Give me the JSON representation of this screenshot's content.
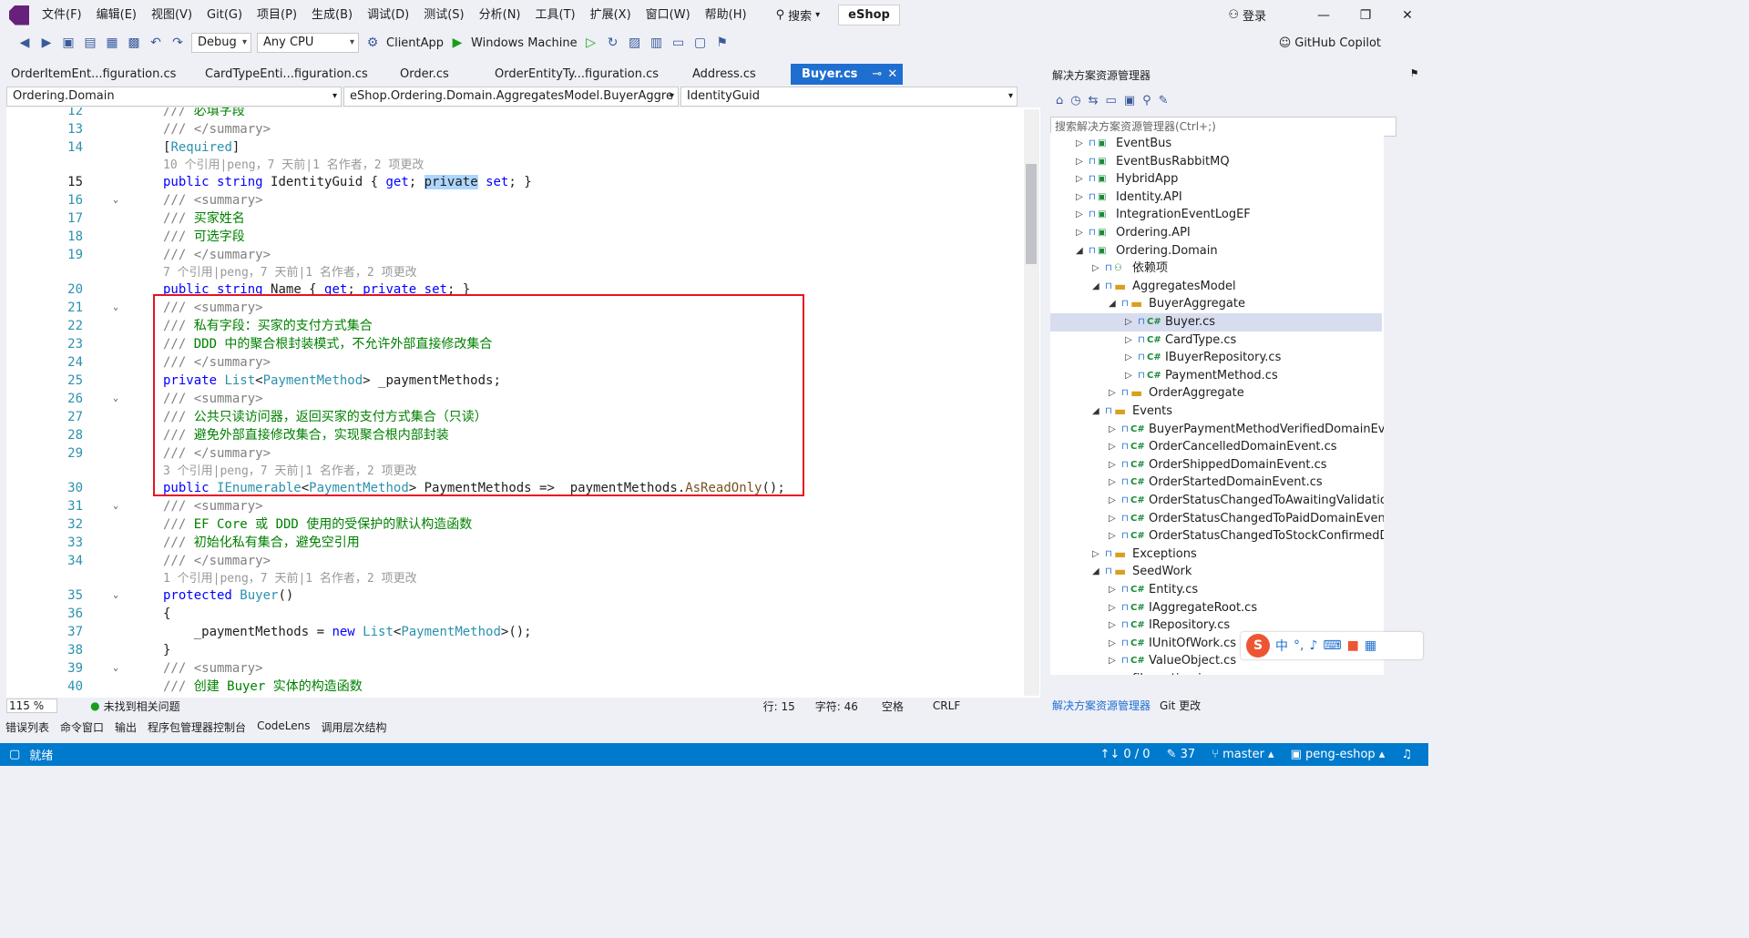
{
  "menubar": {
    "items": [
      "文件(F)",
      "编辑(E)",
      "视图(V)",
      "Git(G)",
      "项目(P)",
      "生成(B)",
      "调试(D)",
      "测试(S)",
      "分析(N)",
      "工具(T)",
      "扩展(X)",
      "窗口(W)",
      "帮助(H)"
    ],
    "search_label": "搜索",
    "solution_name": "eShop",
    "login_label": "登录"
  },
  "toolbar": {
    "config": "Debug",
    "platform": "Any CPU",
    "startup": "ClientApp",
    "run_target": "Windows Machine",
    "copilot": "GitHub Copilot"
  },
  "tabs": [
    {
      "label": "OrderItemEnt...figuration.cs",
      "active": false
    },
    {
      "label": "CardTypeEnti...figuration.cs",
      "active": false
    },
    {
      "label": "Order.cs",
      "active": false
    },
    {
      "label": "OrderEntityTy...figuration.cs",
      "active": false
    },
    {
      "label": "Address.cs",
      "active": false
    },
    {
      "label": "Buyer.cs",
      "active": true
    }
  ],
  "navbar": {
    "project": "Ordering.Domain",
    "type": "eShop.Ordering.Domain.AggregatesModel.BuyerAggre",
    "member": "IdentityGuid"
  },
  "editor": {
    "lines": [
      {
        "n": "12",
        "fold": false,
        "t": [
          [
            "cg",
            "/// "
          ],
          [
            "cm",
            "必填字段"
          ]
        ]
      },
      {
        "n": "13",
        "fold": false,
        "t": [
          [
            "cg",
            "/// </summary>"
          ]
        ]
      },
      {
        "n": "14",
        "fold": false,
        "t": [
          [
            "pl",
            "["
          ],
          [
            "at",
            "Required"
          ],
          [
            "pl",
            "]"
          ]
        ]
      },
      {
        "lens": "10 个引用|peng，7 天前|1 名作者，2 项更改"
      },
      {
        "n": "15",
        "fold": false,
        "cur": true,
        "t": [
          [
            "kw",
            "public "
          ],
          [
            "kw",
            "string "
          ],
          [
            "pl",
            "IdentityGuid { "
          ],
          [
            "kw",
            "get"
          ],
          [
            "pl",
            "; "
          ],
          [
            "hl",
            "private"
          ],
          [
            "pl",
            " "
          ],
          [
            "kw",
            "set"
          ],
          [
            "pl",
            "; }"
          ]
        ]
      },
      {
        "n": "16",
        "fold": true,
        "t": [
          [
            "cg",
            "/// <summary>"
          ]
        ]
      },
      {
        "n": "17",
        "fold": false,
        "t": [
          [
            "cg",
            "/// "
          ],
          [
            "cm",
            "买家姓名"
          ]
        ]
      },
      {
        "n": "18",
        "fold": false,
        "t": [
          [
            "cg",
            "/// "
          ],
          [
            "cm",
            "可选字段"
          ]
        ]
      },
      {
        "n": "19",
        "fold": false,
        "t": [
          [
            "cg",
            "/// </summary>"
          ]
        ]
      },
      {
        "lens": "7 个引用|peng，7 天前|1 名作者，2 项更改"
      },
      {
        "n": "20",
        "fold": false,
        "t": [
          [
            "kw",
            "public "
          ],
          [
            "kw",
            "string "
          ],
          [
            "pl",
            "Name { "
          ],
          [
            "kw",
            "get"
          ],
          [
            "pl",
            "; "
          ],
          [
            "kw",
            "private "
          ],
          [
            "kw",
            "set"
          ],
          [
            "pl",
            "; }"
          ]
        ]
      },
      {
        "n": "21",
        "fold": true,
        "t": [
          [
            "cg",
            "/// <summary>"
          ]
        ]
      },
      {
        "n": "22",
        "fold": false,
        "t": [
          [
            "cg",
            "/// "
          ],
          [
            "cm",
            "私有字段：买家的支付方式集合"
          ]
        ]
      },
      {
        "n": "23",
        "fold": false,
        "t": [
          [
            "cg",
            "/// "
          ],
          [
            "cm",
            "DDD 中的聚合根封装模式，不允许外部直接修改集合"
          ]
        ]
      },
      {
        "n": "24",
        "fold": false,
        "t": [
          [
            "cg",
            "/// </summary>"
          ]
        ]
      },
      {
        "n": "25",
        "fold": false,
        "t": [
          [
            "kw",
            "private "
          ],
          [
            "ty",
            "List"
          ],
          [
            "pl",
            "<"
          ],
          [
            "ty",
            "PaymentMethod"
          ],
          [
            "pl",
            "> _paymentMethods;"
          ]
        ]
      },
      {
        "n": "26",
        "fold": true,
        "t": [
          [
            "cg",
            "/// <summary>"
          ]
        ]
      },
      {
        "n": "27",
        "fold": false,
        "t": [
          [
            "cg",
            "/// "
          ],
          [
            "cm",
            "公共只读访问器，返回买家的支付方式集合（只读）"
          ]
        ]
      },
      {
        "n": "28",
        "fold": false,
        "t": [
          [
            "cg",
            "/// "
          ],
          [
            "cm",
            "避免外部直接修改集合，实现聚合根内部封装"
          ]
        ]
      },
      {
        "n": "29",
        "fold": false,
        "t": [
          [
            "cg",
            "/// </summary>"
          ]
        ]
      },
      {
        "lens": "3 个引用|peng，7 天前|1 名作者，2 项更改"
      },
      {
        "n": "30",
        "fold": false,
        "t": [
          [
            "kw",
            "public "
          ],
          [
            "ty",
            "IEnumerable"
          ],
          [
            "pl",
            "<"
          ],
          [
            "ty",
            "PaymentMethod"
          ],
          [
            "pl",
            "> PaymentMethods => _paymentMethods."
          ],
          [
            "mt",
            "AsReadOnly"
          ],
          [
            "pl",
            "();"
          ]
        ]
      },
      {
        "n": "31",
        "fold": true,
        "t": [
          [
            "cg",
            "/// <summary>"
          ]
        ]
      },
      {
        "n": "32",
        "fold": false,
        "t": [
          [
            "cg",
            "/// "
          ],
          [
            "cm",
            "EF Core 或 DDD 使用的受保护的默认构造函数"
          ]
        ]
      },
      {
        "n": "33",
        "fold": false,
        "t": [
          [
            "cg",
            "/// "
          ],
          [
            "cm",
            "初始化私有集合，避免空引用"
          ]
        ]
      },
      {
        "n": "34",
        "fold": false,
        "t": [
          [
            "cg",
            "/// </summary>"
          ]
        ]
      },
      {
        "lens": "1 个引用|peng，7 天前|1 名作者，2 项更改"
      },
      {
        "n": "35",
        "fold": true,
        "t": [
          [
            "kw",
            "protected "
          ],
          [
            "ty",
            "Buyer"
          ],
          [
            "pl",
            "()"
          ]
        ]
      },
      {
        "n": "36",
        "fold": false,
        "t": [
          [
            "pl",
            "{"
          ]
        ]
      },
      {
        "n": "37",
        "fold": false,
        "t": [
          [
            "pl",
            "    _paymentMethods = "
          ],
          [
            "kw",
            "new "
          ],
          [
            "ty",
            "List"
          ],
          [
            "pl",
            "<"
          ],
          [
            "ty",
            "PaymentMethod"
          ],
          [
            "pl",
            ">();"
          ]
        ]
      },
      {
        "n": "38",
        "fold": false,
        "t": [
          [
            "pl",
            "}"
          ]
        ]
      },
      {
        "n": "39",
        "fold": true,
        "t": [
          [
            "cg",
            "/// <summary>"
          ]
        ]
      },
      {
        "n": "40",
        "fold": false,
        "t": [
          [
            "cg",
            "/// "
          ],
          [
            "cm",
            "创建 Buyer 实体的构造函数"
          ]
        ]
      },
      {
        "n": "41",
        "fold": false,
        "t": [
          [
            "cg",
            "/// </summary>"
          ]
        ]
      }
    ]
  },
  "editor_status": {
    "zoom": "115 %",
    "issues": "未找到相关问题",
    "line": "行: 15",
    "char": "字符: 46",
    "space": "空格",
    "eol": "CRLF"
  },
  "solution_explorer": {
    "title": "解决方案资源管理器",
    "search_placeholder": "搜索解决方案资源管理器(Ctrl+;)",
    "items": [
      {
        "depth": 0,
        "label": "EventBus",
        "kind": "proj",
        "exp": "c"
      },
      {
        "depth": 0,
        "label": "EventBusRabbitMQ",
        "kind": "proj",
        "exp": "c"
      },
      {
        "depth": 0,
        "label": "HybridApp",
        "kind": "web",
        "exp": "c"
      },
      {
        "depth": 0,
        "label": "Identity.API",
        "kind": "web",
        "exp": "c"
      },
      {
        "depth": 0,
        "label": "IntegrationEventLogEF",
        "kind": "proj",
        "exp": "c"
      },
      {
        "depth": 0,
        "label": "Ordering.API",
        "kind": "web",
        "exp": "c"
      },
      {
        "depth": 0,
        "label": "Ordering.Domain",
        "kind": "proj",
        "exp": "o"
      },
      {
        "depth": 1,
        "label": "依赖项",
        "kind": "dep",
        "exp": "c"
      },
      {
        "depth": 1,
        "label": "AggregatesModel",
        "kind": "folder",
        "exp": "o"
      },
      {
        "depth": 2,
        "label": "BuyerAggregate",
        "kind": "folder",
        "exp": "o"
      },
      {
        "depth": 3,
        "label": "Buyer.cs",
        "kind": "cs",
        "exp": "c",
        "sel": true
      },
      {
        "depth": 3,
        "label": "CardType.cs",
        "kind": "cs",
        "exp": "c"
      },
      {
        "depth": 3,
        "label": "IBuyerRepository.cs",
        "kind": "cs",
        "exp": "c"
      },
      {
        "depth": 3,
        "label": "PaymentMethod.cs",
        "kind": "cs",
        "exp": "c"
      },
      {
        "depth": 2,
        "label": "OrderAggregate",
        "kind": "folder",
        "exp": "c"
      },
      {
        "depth": 1,
        "label": "Events",
        "kind": "folder",
        "exp": "o"
      },
      {
        "depth": 2,
        "label": "BuyerPaymentMethodVerifiedDomainEvent",
        "kind": "cs",
        "exp": "c"
      },
      {
        "depth": 2,
        "label": "OrderCancelledDomainEvent.cs",
        "kind": "cs",
        "exp": "c"
      },
      {
        "depth": 2,
        "label": "OrderShippedDomainEvent.cs",
        "kind": "cs",
        "exp": "c"
      },
      {
        "depth": 2,
        "label": "OrderStartedDomainEvent.cs",
        "kind": "cs",
        "exp": "c"
      },
      {
        "depth": 2,
        "label": "OrderStatusChangedToAwaitingValidationD",
        "kind": "cs",
        "exp": "c"
      },
      {
        "depth": 2,
        "label": "OrderStatusChangedToPaidDomainEvent.cs",
        "kind": "cs",
        "exp": "c"
      },
      {
        "depth": 2,
        "label": "OrderStatusChangedToStockConfirmedDor",
        "kind": "cs",
        "exp": "c"
      },
      {
        "depth": 1,
        "label": "Exceptions",
        "kind": "folder",
        "exp": "c"
      },
      {
        "depth": 1,
        "label": "SeedWork",
        "kind": "folder",
        "exp": "o"
      },
      {
        "depth": 2,
        "label": "Entity.cs",
        "kind": "cs",
        "exp": "c"
      },
      {
        "depth": 2,
        "label": "IAggregateRoot.cs",
        "kind": "cs",
        "exp": "c"
      },
      {
        "depth": 2,
        "label": "IRepository.cs",
        "kind": "cs",
        "exp": "c"
      },
      {
        "depth": 2,
        "label": "IUnitOfWork.cs",
        "kind": "cs",
        "exp": "c"
      },
      {
        "depth": 2,
        "label": "ValueObject.cs",
        "kind": "cs",
        "exp": "c"
      },
      {
        "depth": 1,
        "label": "filenesting.json",
        "kind": "file",
        "exp": "n"
      }
    ],
    "bottom_tabs": [
      "解决方案资源管理器",
      "Git 更改"
    ]
  },
  "bottom_tabs": [
    "错误列表",
    "命令窗口",
    "输出",
    "程序包管理器控制台",
    "CodeLens",
    "调用层次结构"
  ],
  "statusbar": {
    "ready": "就绪",
    "sync": "↑↓ 0 / 0",
    "pending": "37",
    "branch": "master",
    "repo": "peng-eshop"
  },
  "ime": {
    "lang": "中"
  }
}
